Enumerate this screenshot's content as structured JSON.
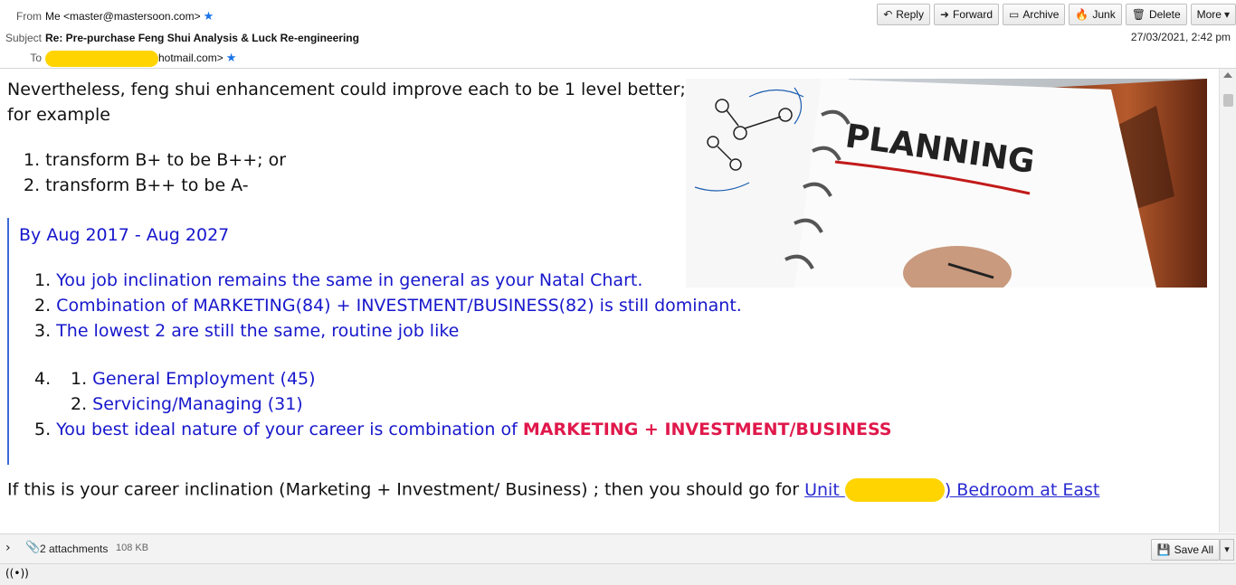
{
  "header": {
    "from_label": "From",
    "from_value": "Me <master@mastersoon.com>",
    "subject_label": "Subject",
    "subject_value": "Re: Pre-purchase Feng Shui Analysis & Luck Re-engineering",
    "to_label": "To",
    "to_suffix": "hotmail.com>",
    "date": "27/03/2021, 2:42 pm"
  },
  "toolbar": {
    "reply": "Reply",
    "forward": "Forward",
    "archive": "Archive",
    "junk": "Junk",
    "delete": "Delete",
    "more": "More"
  },
  "body": {
    "intro_line1": "Nevertheless, feng shui enhancement could improve each to be 1 level better;",
    "intro_line2": "for example",
    "list1": [
      "transform B+ to be B++; or",
      "transform B++ to be A-"
    ],
    "quote_heading": "By Aug 2017 - Aug 2027",
    "quote_items": [
      "You job inclination remains the same in general as your Natal Chart.",
      "Combination of MARKETING(84) + INVESTMENT/BUSINESS(82) is still dominant.",
      "The lowest 2 are still the same, routine job like"
    ],
    "sub_items": [
      "General Employment  (45)",
      "Servicing/Managing (31)"
    ],
    "item5_prefix": "You best ideal nature of your career is combination of ",
    "item5_highlight": "MARKETING + INVESTMENT/BUSINESS",
    "career_text": "If this is your career inclination (Marketing + Investment/ Business) ; then you should go for ",
    "link_prefix": "Unit ",
    "link_suffix": ") Bedroom at East",
    "planning_text": "PLANNING"
  },
  "attachments": {
    "label": "2 attachments",
    "size": "108 KB",
    "save_all": "Save All"
  },
  "colors": {
    "quote_blue": "#1717cc",
    "highlight_red": "#e0184b",
    "redaction": "#ffd400"
  }
}
